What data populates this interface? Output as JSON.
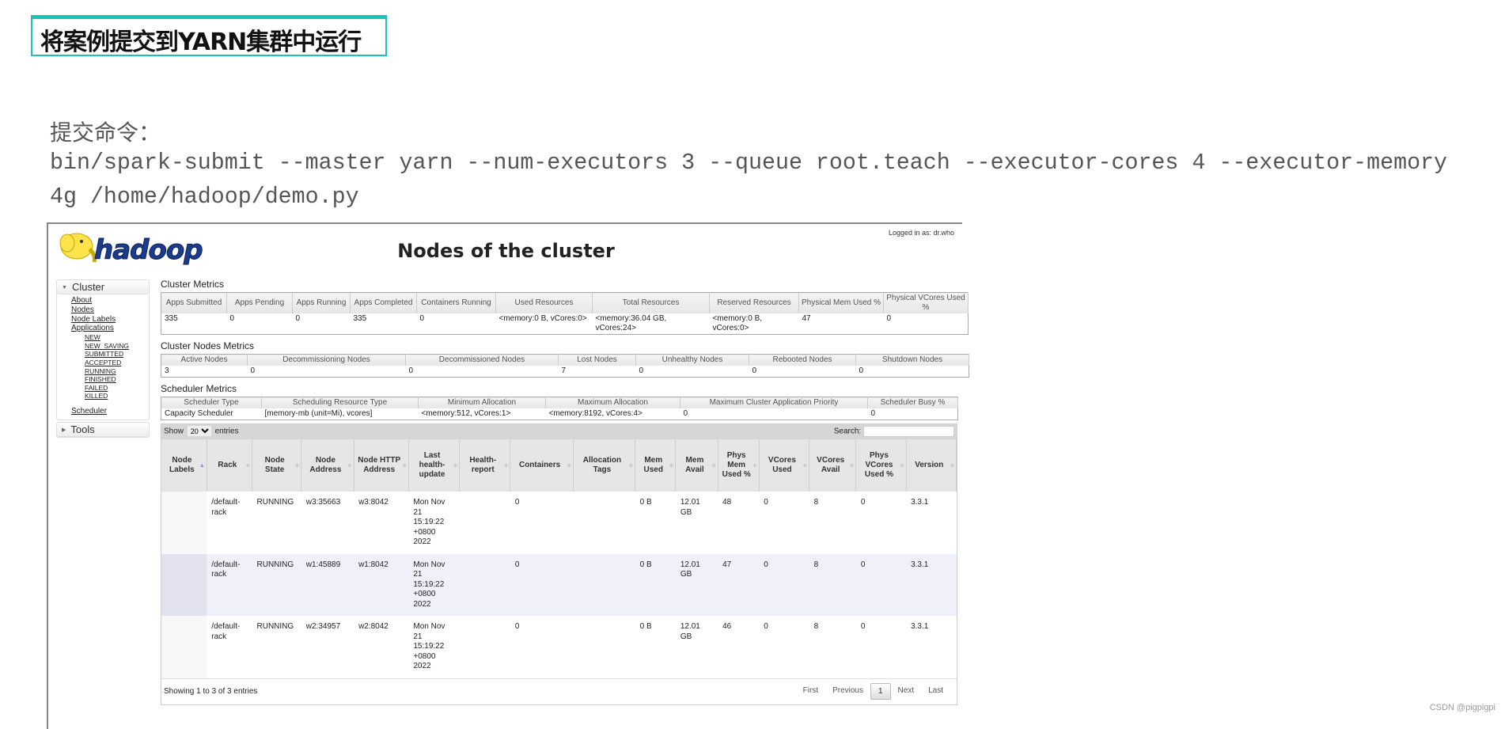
{
  "slide": {
    "title": "将案例提交到YARN集群中运行",
    "cmd_label": "提交命令：",
    "cmd_line1": "bin/spark-submit --master yarn --num-executors 3 --queue root.teach --executor-cores 4 --executor-memory",
    "cmd_line2": "4g /home/hadoop/demo.py",
    "watermark": "CSDN @pigpigpi",
    "accent": "#19c4b6"
  },
  "header": {
    "logo_text": "hadoop",
    "title": "Nodes of the cluster",
    "logged_in": "Logged in as: dr.who"
  },
  "sidebar": {
    "cluster": "Cluster",
    "links": [
      "About",
      "Nodes",
      "Node Labels",
      "Applications"
    ],
    "app_states": [
      "NEW",
      "NEW_SAVING",
      "SUBMITTED",
      "ACCEPTED",
      "RUNNING",
      "FINISHED",
      "FAILED",
      "KILLED"
    ],
    "scheduler": "Scheduler",
    "tools": "Tools"
  },
  "cluster_metrics": {
    "label": "Cluster Metrics",
    "headers": [
      "Apps Submitted",
      "Apps Pending",
      "Apps Running",
      "Apps Completed",
      "Containers Running",
      "Used Resources",
      "Total Resources",
      "Reserved Resources",
      "Physical Mem Used %",
      "Physical VCores Used %"
    ],
    "values": [
      "335",
      "0",
      "0",
      "335",
      "0",
      "<memory:0 B, vCores:0>",
      "<memory:36.04 GB, vCores:24>",
      "<memory:0 B, vCores:0>",
      "47",
      "0"
    ]
  },
  "nodes_metrics": {
    "label": "Cluster Nodes Metrics",
    "headers": [
      "Active Nodes",
      "Decommissioning Nodes",
      "Decommissioned Nodes",
      "Lost Nodes",
      "Unhealthy Nodes",
      "Rebooted Nodes",
      "Shutdown Nodes"
    ],
    "values": [
      "3",
      "0",
      "0",
      "7",
      "0",
      "0",
      "0"
    ]
  },
  "scheduler_metrics": {
    "label": "Scheduler Metrics",
    "headers": [
      "Scheduler Type",
      "Scheduling Resource Type",
      "Minimum Allocation",
      "Maximum Allocation",
      "Maximum Cluster Application Priority",
      "Scheduler Busy %"
    ],
    "values": [
      "Capacity Scheduler",
      "[memory-mb (unit=Mi), vcores]",
      "<memory:512, vCores:1>",
      "<memory:8192, vCores:4>",
      "0",
      "0"
    ]
  },
  "nodes_table": {
    "show": "Show",
    "entries_value": "20",
    "entries": "entries",
    "search": "Search:",
    "search_value": "",
    "headers": [
      "Node Labels",
      "Rack",
      "Node State",
      "Node Address",
      "Node HTTP Address",
      "Last health-update",
      "Health-report",
      "Containers",
      "Allocation Tags",
      "Mem Used",
      "Mem Avail",
      "Phys Mem Used %",
      "VCores Used",
      "VCores Avail",
      "Phys VCores Used %",
      "Version"
    ],
    "rows": [
      [
        "",
        "/default-rack",
        "RUNNING",
        "w3:35663",
        "w3:8042",
        "Mon Nov 21 15:19:22 +0800 2022",
        "",
        "0",
        "",
        "0 B",
        "12.01 GB",
        "48",
        "0",
        "8",
        "0",
        "3.3.1"
      ],
      [
        "",
        "/default-rack",
        "RUNNING",
        "w1:45889",
        "w1:8042",
        "Mon Nov 21 15:19:22 +0800 2022",
        "",
        "0",
        "",
        "0 B",
        "12.01 GB",
        "47",
        "0",
        "8",
        "0",
        "3.3.1"
      ],
      [
        "",
        "/default-rack",
        "RUNNING",
        "w2:34957",
        "w2:8042",
        "Mon Nov 21 15:19:22 +0800 2022",
        "",
        "0",
        "",
        "0 B",
        "12.01 GB",
        "46",
        "0",
        "8",
        "0",
        "3.3.1"
      ]
    ],
    "info": "Showing 1 to 3 of 3 entries",
    "pager": {
      "first": "First",
      "previous": "Previous",
      "current": "1",
      "next": "Next",
      "last": "Last"
    }
  }
}
